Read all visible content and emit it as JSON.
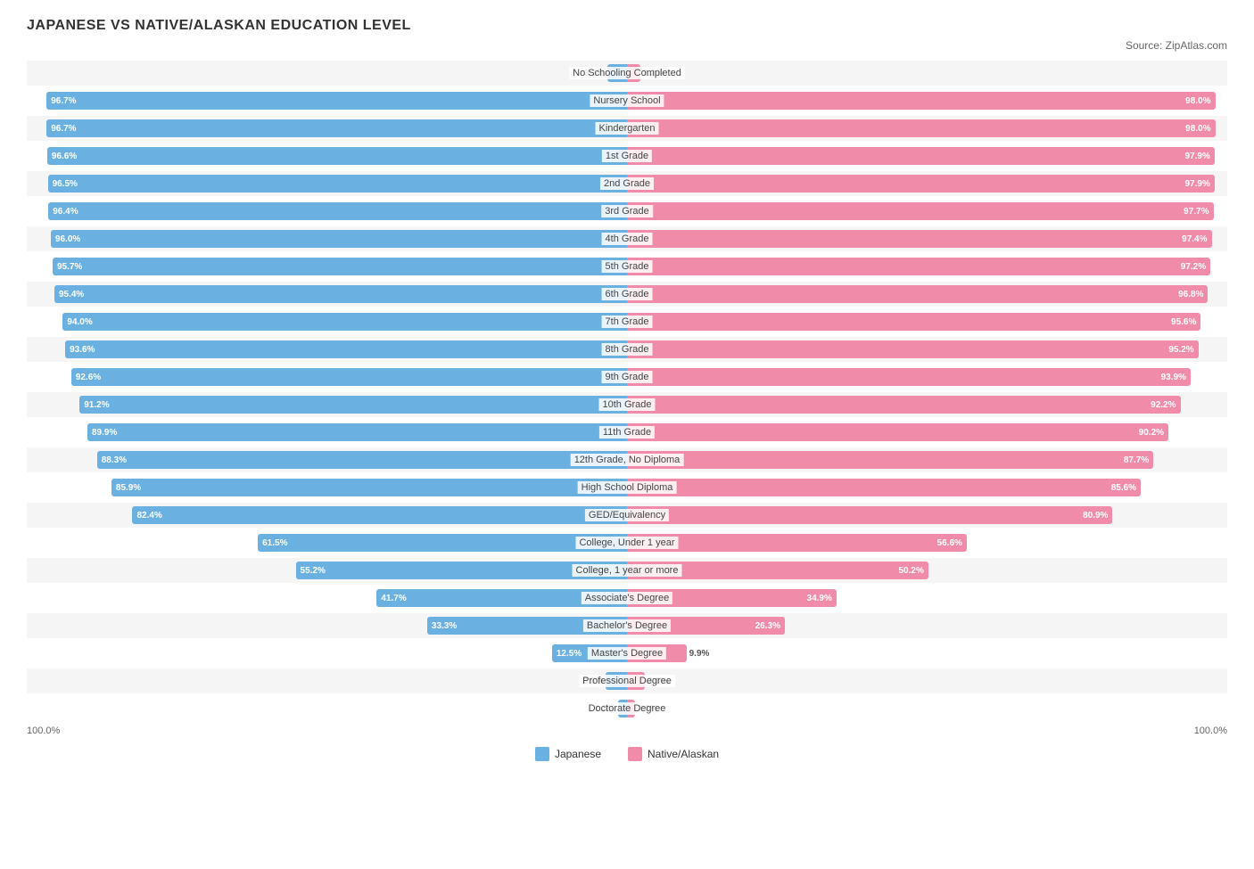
{
  "title": "JAPANESE VS NATIVE/ALASKAN EDUCATION LEVEL",
  "source": "Source: ZipAtlas.com",
  "legend": {
    "japanese_label": "Japanese",
    "alaskan_label": "Native/Alaskan",
    "japanese_color": "#6ab0e0",
    "alaskan_color": "#f08caa"
  },
  "axis": {
    "left": "100.0%",
    "right": "100.0%"
  },
  "rows": [
    {
      "label": "No Schooling Completed",
      "left_val": 3.3,
      "right_val": 2.2,
      "left_pct": "3.3%",
      "right_pct": "2.2%"
    },
    {
      "label": "Nursery School",
      "left_val": 96.7,
      "right_val": 98.0,
      "left_pct": "96.7%",
      "right_pct": "98.0%"
    },
    {
      "label": "Kindergarten",
      "left_val": 96.7,
      "right_val": 98.0,
      "left_pct": "96.7%",
      "right_pct": "98.0%"
    },
    {
      "label": "1st Grade",
      "left_val": 96.6,
      "right_val": 97.9,
      "left_pct": "96.6%",
      "right_pct": "97.9%"
    },
    {
      "label": "2nd Grade",
      "left_val": 96.5,
      "right_val": 97.9,
      "left_pct": "96.5%",
      "right_pct": "97.9%"
    },
    {
      "label": "3rd Grade",
      "left_val": 96.4,
      "right_val": 97.7,
      "left_pct": "96.4%",
      "right_pct": "97.7%"
    },
    {
      "label": "4th Grade",
      "left_val": 96.0,
      "right_val": 97.4,
      "left_pct": "96.0%",
      "right_pct": "97.4%"
    },
    {
      "label": "5th Grade",
      "left_val": 95.7,
      "right_val": 97.2,
      "left_pct": "95.7%",
      "right_pct": "97.2%"
    },
    {
      "label": "6th Grade",
      "left_val": 95.4,
      "right_val": 96.8,
      "left_pct": "95.4%",
      "right_pct": "96.8%"
    },
    {
      "label": "7th Grade",
      "left_val": 94.0,
      "right_val": 95.6,
      "left_pct": "94.0%",
      "right_pct": "95.6%"
    },
    {
      "label": "8th Grade",
      "left_val": 93.6,
      "right_val": 95.2,
      "left_pct": "93.6%",
      "right_pct": "95.2%"
    },
    {
      "label": "9th Grade",
      "left_val": 92.6,
      "right_val": 93.9,
      "left_pct": "92.6%",
      "right_pct": "93.9%"
    },
    {
      "label": "10th Grade",
      "left_val": 91.2,
      "right_val": 92.2,
      "left_pct": "91.2%",
      "right_pct": "92.2%"
    },
    {
      "label": "11th Grade",
      "left_val": 89.9,
      "right_val": 90.2,
      "left_pct": "89.9%",
      "right_pct": "90.2%"
    },
    {
      "label": "12th Grade, No Diploma",
      "left_val": 88.3,
      "right_val": 87.7,
      "left_pct": "88.3%",
      "right_pct": "87.7%"
    },
    {
      "label": "High School Diploma",
      "left_val": 85.9,
      "right_val": 85.6,
      "left_pct": "85.9%",
      "right_pct": "85.6%"
    },
    {
      "label": "GED/Equivalency",
      "left_val": 82.4,
      "right_val": 80.9,
      "left_pct": "82.4%",
      "right_pct": "80.9%"
    },
    {
      "label": "College, Under 1 year",
      "left_val": 61.5,
      "right_val": 56.6,
      "left_pct": "61.5%",
      "right_pct": "56.6%"
    },
    {
      "label": "College, 1 year or more",
      "left_val": 55.2,
      "right_val": 50.2,
      "left_pct": "55.2%",
      "right_pct": "50.2%"
    },
    {
      "label": "Associate's Degree",
      "left_val": 41.7,
      "right_val": 34.9,
      "left_pct": "41.7%",
      "right_pct": "34.9%"
    },
    {
      "label": "Bachelor's Degree",
      "left_val": 33.3,
      "right_val": 26.3,
      "left_pct": "33.3%",
      "right_pct": "26.3%"
    },
    {
      "label": "Master's Degree",
      "left_val": 12.5,
      "right_val": 9.9,
      "left_pct": "12.5%",
      "right_pct": "9.9%"
    },
    {
      "label": "Professional Degree",
      "left_val": 3.5,
      "right_val": 3.0,
      "left_pct": "3.5%",
      "right_pct": "3.0%"
    },
    {
      "label": "Doctorate Degree",
      "left_val": 1.5,
      "right_val": 1.3,
      "left_pct": "1.5%",
      "right_pct": "1.3%"
    }
  ]
}
